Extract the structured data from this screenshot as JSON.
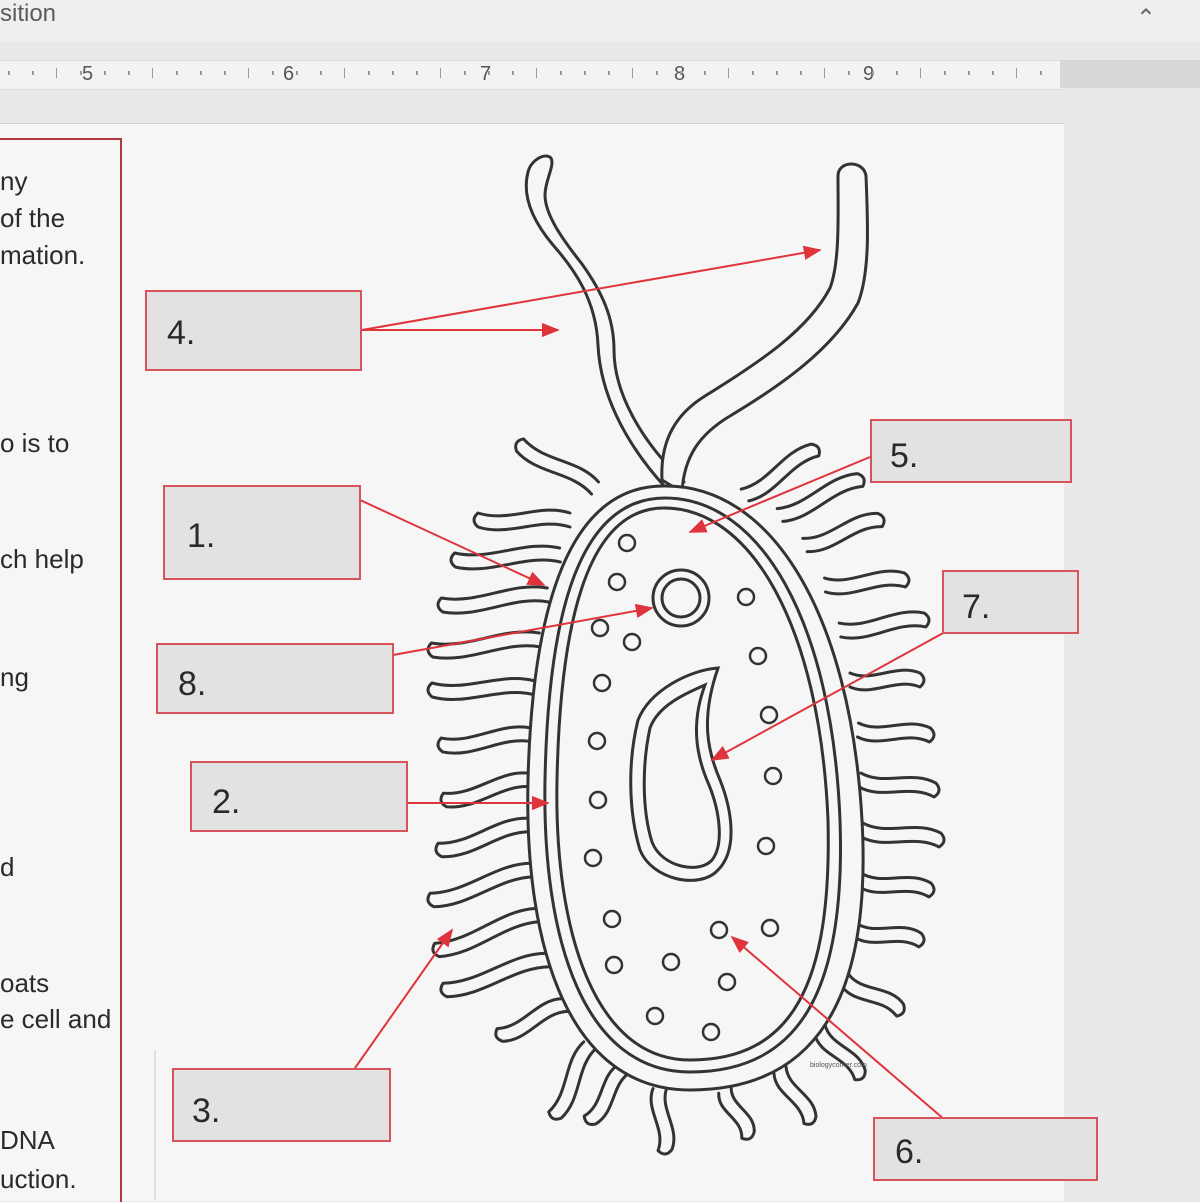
{
  "header": {
    "title_fragment": "sition",
    "collapse_icon": "chevron-up-icon"
  },
  "ruler": {
    "numbers": [
      "5",
      "6",
      "7",
      "8",
      "9"
    ]
  },
  "left_column": {
    "lines": [
      "ny",
      "of the",
      "mation.",
      "o is to",
      "ch help",
      "ng",
      "d",
      "oats",
      "e cell and",
      "DNA",
      "uction."
    ]
  },
  "diagram": {
    "labels": [
      "4.",
      "1.",
      "8.",
      "2.",
      "3.",
      "5.",
      "7.",
      "6."
    ],
    "credit": "biologycorner.com",
    "colors": {
      "arrow": "#e0343c",
      "box_border": "#d8545c",
      "box_fill": "#e2e2e3",
      "outline": "#333333"
    }
  }
}
